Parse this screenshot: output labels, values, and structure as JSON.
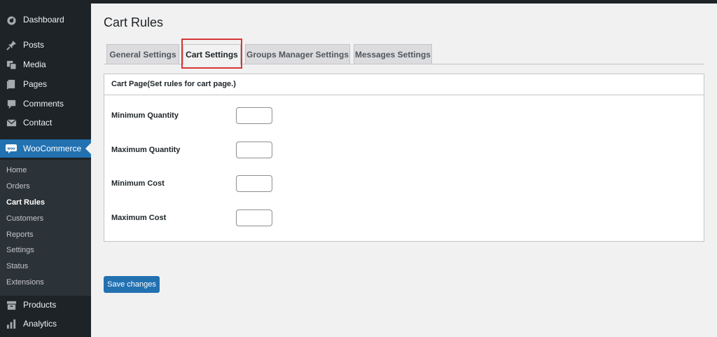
{
  "sidebar": {
    "top_items": [
      {
        "label": "Dashboard",
        "icon": "dashboard-icon"
      },
      {
        "label": "Posts",
        "icon": "pin-icon"
      },
      {
        "label": "Media",
        "icon": "media-icon"
      },
      {
        "label": "Pages",
        "icon": "pages-icon"
      },
      {
        "label": "Comments",
        "icon": "comments-icon"
      },
      {
        "label": "Contact",
        "icon": "mail-icon"
      },
      {
        "label": "WooCommerce",
        "icon": "woo-icon"
      }
    ],
    "woo_submenu": [
      {
        "label": "Home"
      },
      {
        "label": "Orders"
      },
      {
        "label": "Cart Rules"
      },
      {
        "label": "Customers"
      },
      {
        "label": "Reports"
      },
      {
        "label": "Settings"
      },
      {
        "label": "Status"
      },
      {
        "label": "Extensions"
      }
    ],
    "bottom_items": [
      {
        "label": "Products",
        "icon": "products-icon"
      },
      {
        "label": "Analytics",
        "icon": "analytics-icon"
      }
    ]
  },
  "page": {
    "title": "Cart Rules",
    "tabs": [
      {
        "label": "General Settings"
      },
      {
        "label": "Cart Settings"
      },
      {
        "label": "Groups Manager Settings"
      },
      {
        "label": "Messages Settings"
      }
    ],
    "active_tab": "Cart Settings",
    "panel": {
      "title": "Cart Page(Set rules for cart page.)",
      "fields": [
        {
          "label": "Minimum Quantity",
          "value": ""
        },
        {
          "label": "Maximum Quantity",
          "value": ""
        },
        {
          "label": "Minimum Cost",
          "value": ""
        },
        {
          "label": "Maximum Cost",
          "value": ""
        }
      ]
    },
    "save_label": "Save changes"
  },
  "colors": {
    "sidebar_bg": "#1d2327",
    "accent": "#2271b1",
    "highlight": "#d63638"
  }
}
